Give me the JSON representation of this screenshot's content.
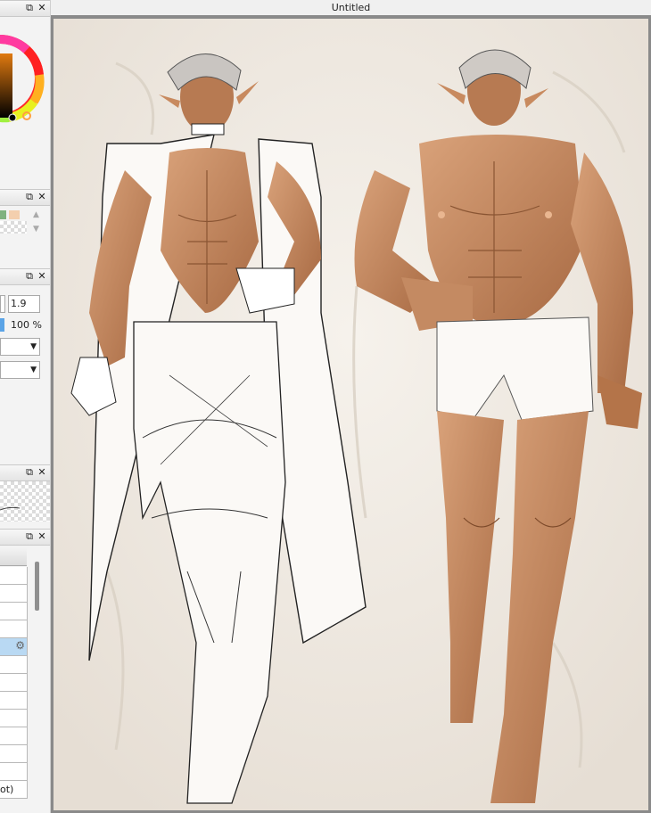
{
  "window": {
    "title": "Untitled"
  },
  "panel_buttons": {
    "restore": "⧉",
    "close": "✕"
  },
  "brush": {
    "size": "1.9",
    "opacity": "100 %"
  },
  "layers": {
    "row_label": "ot)"
  },
  "colors": {
    "swatch_green": "#7fb27f",
    "swatch_peach": "#f3cfae",
    "selected_layer": "#b9d9f3"
  },
  "icons": {
    "gear": "⚙",
    "triangle_up": "▲",
    "triangle_down": "▼"
  }
}
